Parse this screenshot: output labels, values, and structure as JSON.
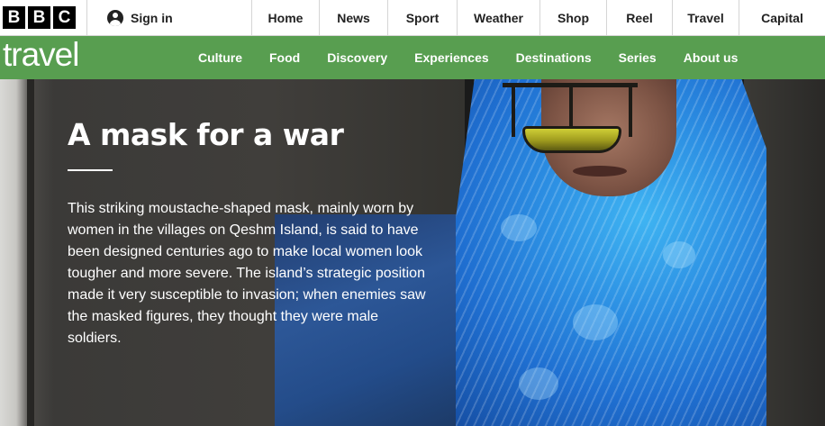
{
  "bbc_logo": [
    "B",
    "B",
    "C"
  ],
  "account": {
    "signin_label": "Sign in",
    "icon": "user-icon"
  },
  "top_nav": [
    "Home",
    "News",
    "Sport",
    "Weather",
    "Shop",
    "Reel",
    "Travel",
    "Capital"
  ],
  "travel": {
    "logo_text": "travel",
    "brand_color": "#589e50",
    "nav": [
      "Culture",
      "Food",
      "Discovery",
      "Experiences",
      "Destinations",
      "Series",
      "About us"
    ]
  },
  "hero": {
    "title": "A mask for a war",
    "body": "This striking moustache-shaped mask, mainly worn by women in the villages on Qeshm Island, is said to have been designed centuries ago to make local women look tougher and more severe. The island’s strategic position made it very susceptible to invasion; when enemies saw the masked figures, they thought they were male soldiers."
  }
}
